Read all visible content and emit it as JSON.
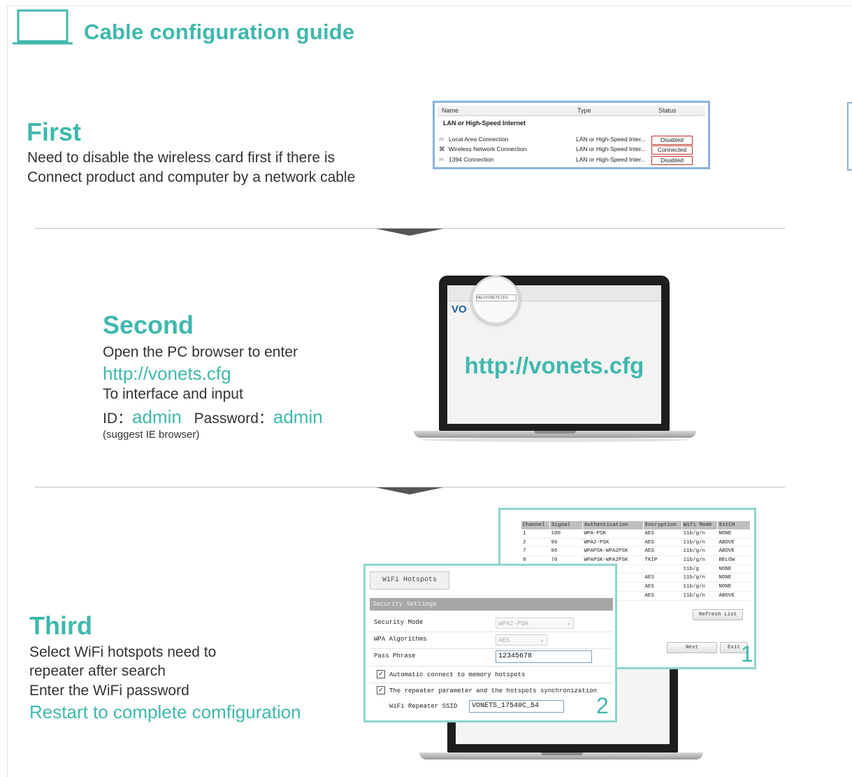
{
  "header": {
    "title": "Cable configuration guide",
    "icon": "laptop-outline-icon"
  },
  "first": {
    "title": "First",
    "line1": "Need to disable the wireless card first if there is",
    "line2": "Connect product and computer by a network cable",
    "panel": {
      "col_name": "Name",
      "col_type": "Type",
      "col_status": "Status",
      "group": "LAN or High-Speed Internet",
      "rows": [
        {
          "name": "Local Area Connection",
          "type": "LAN or High-Speed Inter...",
          "status": "Disabled"
        },
        {
          "name": "Wireless Network Connection",
          "type": "LAN or High-Speed Inter...",
          "status": "Connected"
        },
        {
          "name": "1394 Connection",
          "type": "LAN or High-Speed Inter...",
          "status": "Disabled"
        }
      ]
    }
  },
  "second": {
    "title": "Second",
    "line1": "Open the PC browser to enter",
    "url": "http://vonets.cfg",
    "line2": "To interface and input",
    "id_label": "ID：",
    "id_value": "admin",
    "pw_label": "Password：",
    "pw_value": "admin",
    "note": "(suggest IE browser)",
    "screen_url": "http://vonets.cfg",
    "browser_address": "http://VONETS.CFG",
    "browser_logo": "VO"
  },
  "third": {
    "title": "Third",
    "line1": "Select WiFi hotspots need to",
    "line2": "repeater after search",
    "line3": "Enter the WiFi password",
    "line4": "Restart to complete comfiguration",
    "scan": {
      "headers": [
        "Channel",
        "Signal",
        "Authentication",
        "Encryption",
        "Wifi Mode",
        "ExtCH"
      ],
      "rows": [
        [
          "1",
          "100",
          "WPA-PSK",
          "AES",
          "11b/g/n",
          "NONE"
        ],
        [
          "2",
          "96",
          "WPA2-PSK",
          "AES",
          "11b/g/n",
          "ABOVE"
        ],
        [
          "7",
          "96",
          "WPAPSK-WPA2PSK",
          "AES",
          "11b/g/n",
          "ABOVE"
        ],
        [
          "8",
          "70",
          "WPAPSK-WPA2PSK",
          "TKIP",
          "11b/g/n",
          "BELOW"
        ],
        [
          "",
          "",
          "",
          "",
          "11b/g",
          "NONE"
        ],
        [
          "",
          "",
          "",
          "AES",
          "11b/g/n",
          "NONE"
        ],
        [
          "",
          "",
          "PSK",
          "AES",
          "11b/g/n",
          "NONE"
        ],
        [
          "",
          "",
          "",
          "AES",
          "11b/g/n",
          "ABOVE"
        ]
      ],
      "refresh_label": "Refresh List",
      "next_label": "Next",
      "exit_label": "Exit",
      "callout": "1"
    },
    "wifi": {
      "tab": "WiFi Hotspots",
      "section": "Security Settings",
      "security_mode_label": "Security Mode",
      "security_mode_value": "WPA2-PSK",
      "wpa_label": "WPA Algorithms",
      "wpa_value": "AES",
      "pass_label": "Pass Phrase",
      "pass_value": "12345678",
      "auto_connect": "Automatic connect to memory hotspots",
      "sync": "The repeater parameter and the hotspots synchronization",
      "ssid_label": "WiFi Repeater SSID",
      "ssid_value": "VONETS_17540C_54",
      "callout": "2"
    }
  }
}
